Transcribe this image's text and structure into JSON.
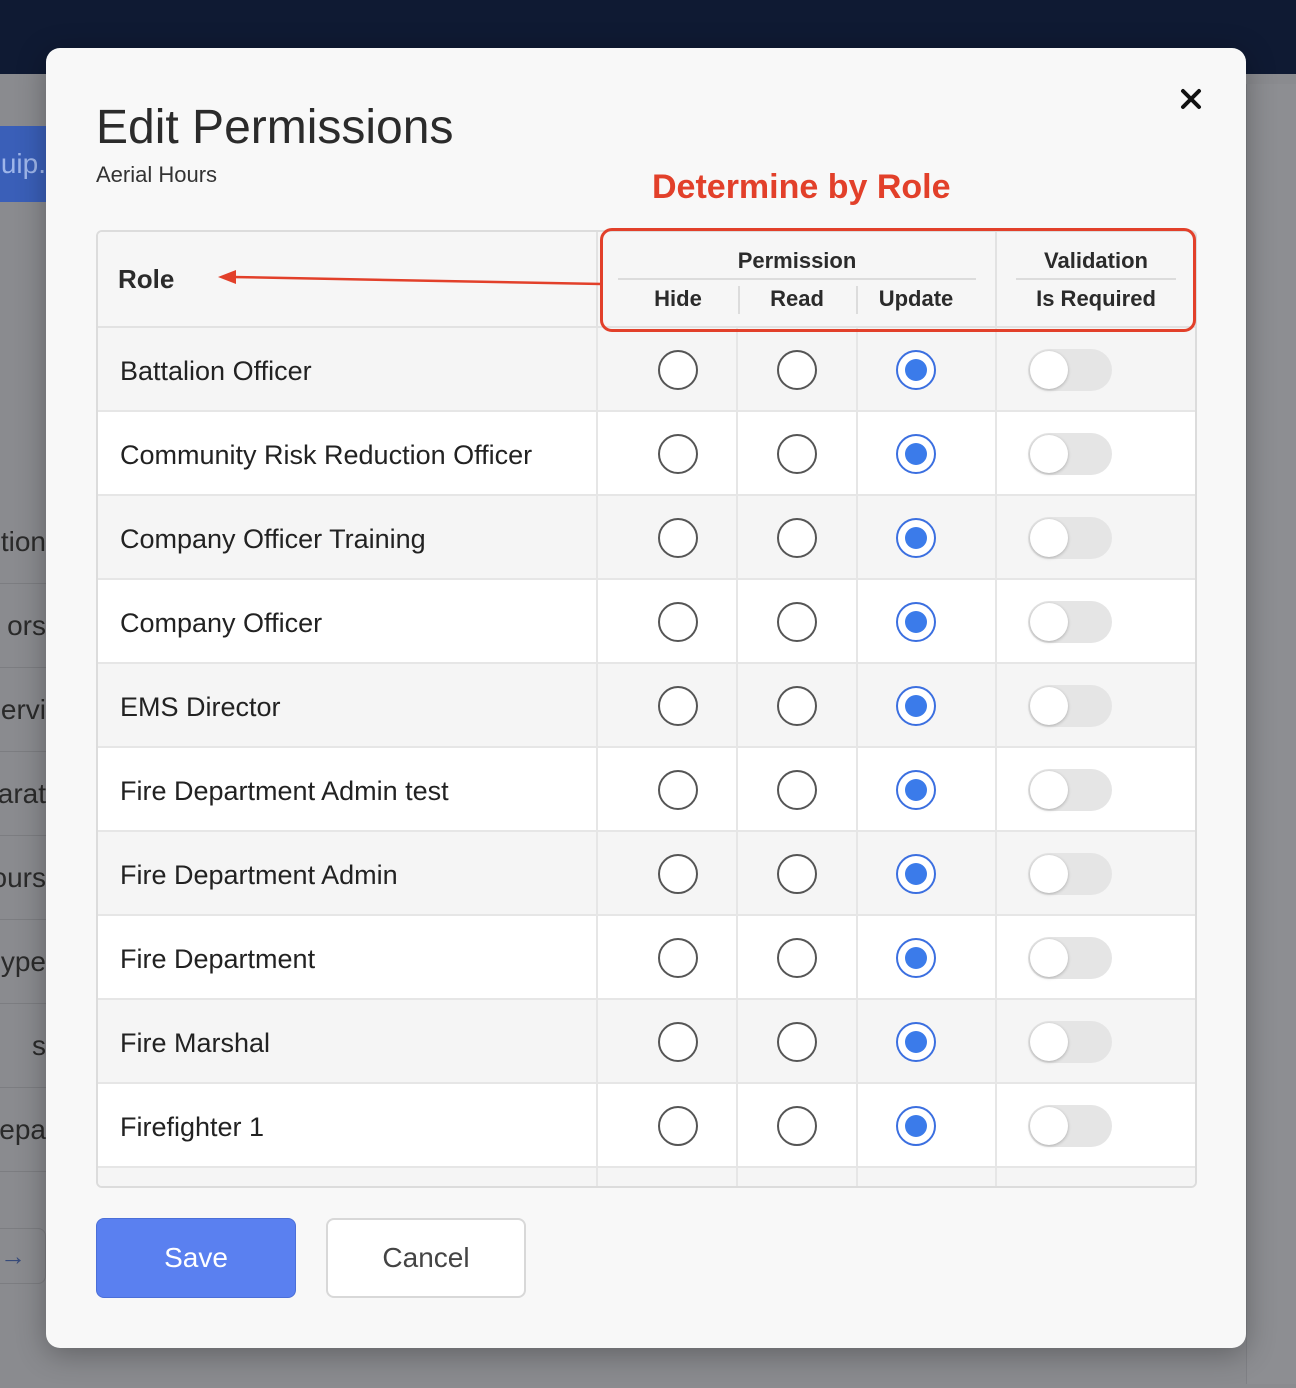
{
  "background": {
    "tab_fragment": "uip.",
    "row_fragments": [
      "tion",
      "ors",
      "ervi",
      "arat",
      "ours",
      "ype",
      "s",
      "epa"
    ],
    "arrow_glyph": "→"
  },
  "modal": {
    "title": "Edit Permissions",
    "subtitle": "Aerial Hours",
    "close_label": "×",
    "annotation": "Determine by Role"
  },
  "table": {
    "role_header": "Role",
    "permission_header": "Permission",
    "validation_header": "Validation",
    "columns": [
      "Hide",
      "Read",
      "Update"
    ],
    "validation_column": "Is Required",
    "rows": [
      {
        "role": "Battalion Officer",
        "permission": "Update",
        "required": false
      },
      {
        "role": "Community Risk Reduction Officer",
        "permission": "Update",
        "required": false
      },
      {
        "role": "Company Officer Training",
        "permission": "Update",
        "required": false
      },
      {
        "role": "Company Officer",
        "permission": "Update",
        "required": false
      },
      {
        "role": "EMS Director",
        "permission": "Update",
        "required": false
      },
      {
        "role": "Fire Department Admin test",
        "permission": "Update",
        "required": false
      },
      {
        "role": "Fire Department Admin",
        "permission": "Update",
        "required": false
      },
      {
        "role": "Fire Department",
        "permission": "Update",
        "required": false
      },
      {
        "role": "Fire Marshal",
        "permission": "Update",
        "required": false
      },
      {
        "role": "Firefighter 1",
        "permission": "Update",
        "required": false
      }
    ]
  },
  "buttons": {
    "save": "Save",
    "cancel": "Cancel"
  },
  "colors": {
    "accent": "#3b7bea",
    "save_button": "#5a80f0",
    "annotation": "#e2402a"
  }
}
